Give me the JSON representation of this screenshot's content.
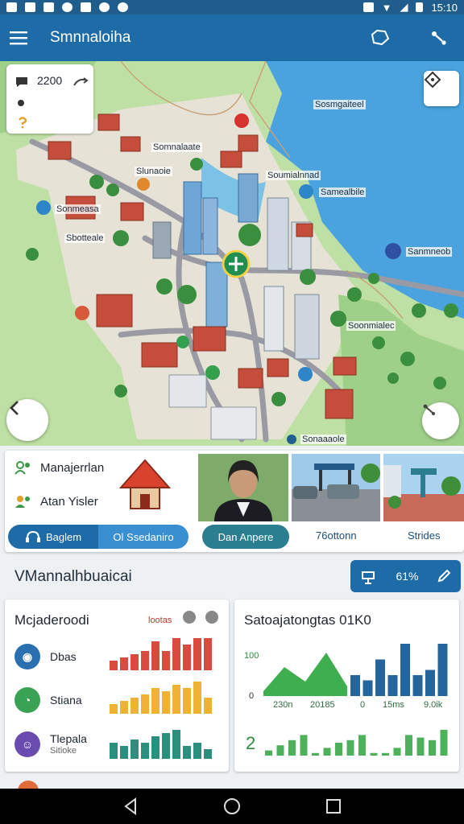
{
  "status_bar": {
    "time": "15:10"
  },
  "app_bar": {
    "title": "Smnnaloiha"
  },
  "map": {
    "zoom_value": "2200",
    "labels": [
      "Sosmgaiteel",
      "Somnalaate",
      "Slunaoie",
      "Soumialnnad",
      "Samealbile",
      "Sonmeasa",
      "Sbotteale",
      "Sanmneob",
      "Soonmialec",
      "Sonaaaole"
    ]
  },
  "gallery": {
    "rows": [
      "Manajerrlan",
      "Atan Yisler"
    ],
    "segment": {
      "left": "Baglem",
      "right": "Ol Ssedaniro"
    },
    "pill": "Dan Anpere",
    "thumb_labels": [
      "76ottonn",
      "Strides"
    ]
  },
  "section": {
    "title": "VMannalhbuaicai",
    "action_value": "61%"
  },
  "left_card": {
    "title": "Mcjaderoodi",
    "tag": "lootas",
    "metrics": [
      {
        "label": "Dbas",
        "sub": "",
        "icon": "globe-icon",
        "color": "#2a6fb0"
      },
      {
        "label": "Stiana",
        "sub": "",
        "icon": "leaf-icon",
        "color": "#3aa255"
      },
      {
        "label": "Tlepala",
        "sub": "Sitioke",
        "icon": "person-icon",
        "color": "#6a4bb0"
      }
    ]
  },
  "right_card": {
    "title": "Satoajatongtas 01K0",
    "y_label": "100",
    "zero_label": "0",
    "bottom_value": "2",
    "x_labels": [
      "230n",
      "20185",
      "0",
      "15ms",
      "9.0ik"
    ]
  },
  "chart_data": [
    {
      "type": "bar",
      "series": [
        {
          "values": [
            3,
            4,
            5,
            6,
            9,
            6,
            10,
            8,
            10,
            10
          ]
        }
      ],
      "colors": [
        "#d94b3d"
      ]
    },
    {
      "type": "bar",
      "series": [
        {
          "values": [
            3,
            4,
            5,
            6,
            8,
            7,
            9,
            8,
            10,
            5
          ]
        }
      ],
      "colors": [
        "#f0b232"
      ]
    },
    {
      "type": "bar",
      "series": [
        {
          "values": [
            5,
            4,
            6,
            5,
            7,
            8,
            9,
            4,
            5,
            3
          ]
        }
      ],
      "colors": [
        "#2b8f7d"
      ]
    },
    {
      "type": "area",
      "series": [
        {
          "values": [
            1,
            6,
            3,
            9,
            2
          ]
        }
      ],
      "colors": [
        "#3fae4f"
      ]
    },
    {
      "type": "bar",
      "series": [
        {
          "values": [
            4,
            3,
            7,
            4,
            10,
            4,
            5,
            10
          ]
        }
      ],
      "colors": [
        "#24659e"
      ]
    },
    {
      "type": "bar",
      "series": [
        {
          "values": [
            2,
            4,
            6,
            8,
            1,
            3,
            5,
            6,
            8,
            1,
            1,
            3,
            8,
            7,
            6,
            10
          ]
        }
      ],
      "colors": [
        "#4db05a"
      ]
    }
  ]
}
